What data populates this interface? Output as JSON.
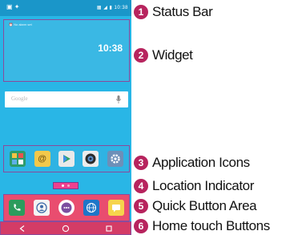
{
  "phone": {
    "status_time": "10:38",
    "status_left_icons": "▣ ✦",
    "status_right_icons": "▦ ◢ ▮",
    "widget": {
      "alarm_text": "⏰ No alarm set",
      "time": "10:38"
    },
    "search": {
      "placeholder": "Google"
    },
    "app_icons": [
      "people-icon",
      "email-icon",
      "play-store-icon",
      "camera-icon",
      "settings-icon"
    ],
    "quick_buttons": [
      "phone-icon",
      "contacts-icon",
      "apps-icon",
      "browser-icon",
      "messaging-icon"
    ],
    "nav_buttons": [
      "back-button",
      "home-button",
      "recent-apps-button"
    ],
    "page_indicator": {
      "current": 1,
      "total": 2
    }
  },
  "callouts": [
    {
      "number": "1",
      "label": "Status Bar"
    },
    {
      "number": "2",
      "label": "Widget"
    },
    {
      "number": "3",
      "label": "Application Icons"
    },
    {
      "number": "4",
      "label": "Location Indicator"
    },
    {
      "number": "5",
      "label": "Quick Button Area"
    },
    {
      "number": "6",
      "label": "Home touch Buttons"
    }
  ],
  "colors": {
    "screen_bg": "#29b6e6",
    "badge": "#b7245e",
    "quick_bar": "#e94d6f",
    "nav_bar": "#d43c66",
    "indicator": "#f0408f"
  }
}
